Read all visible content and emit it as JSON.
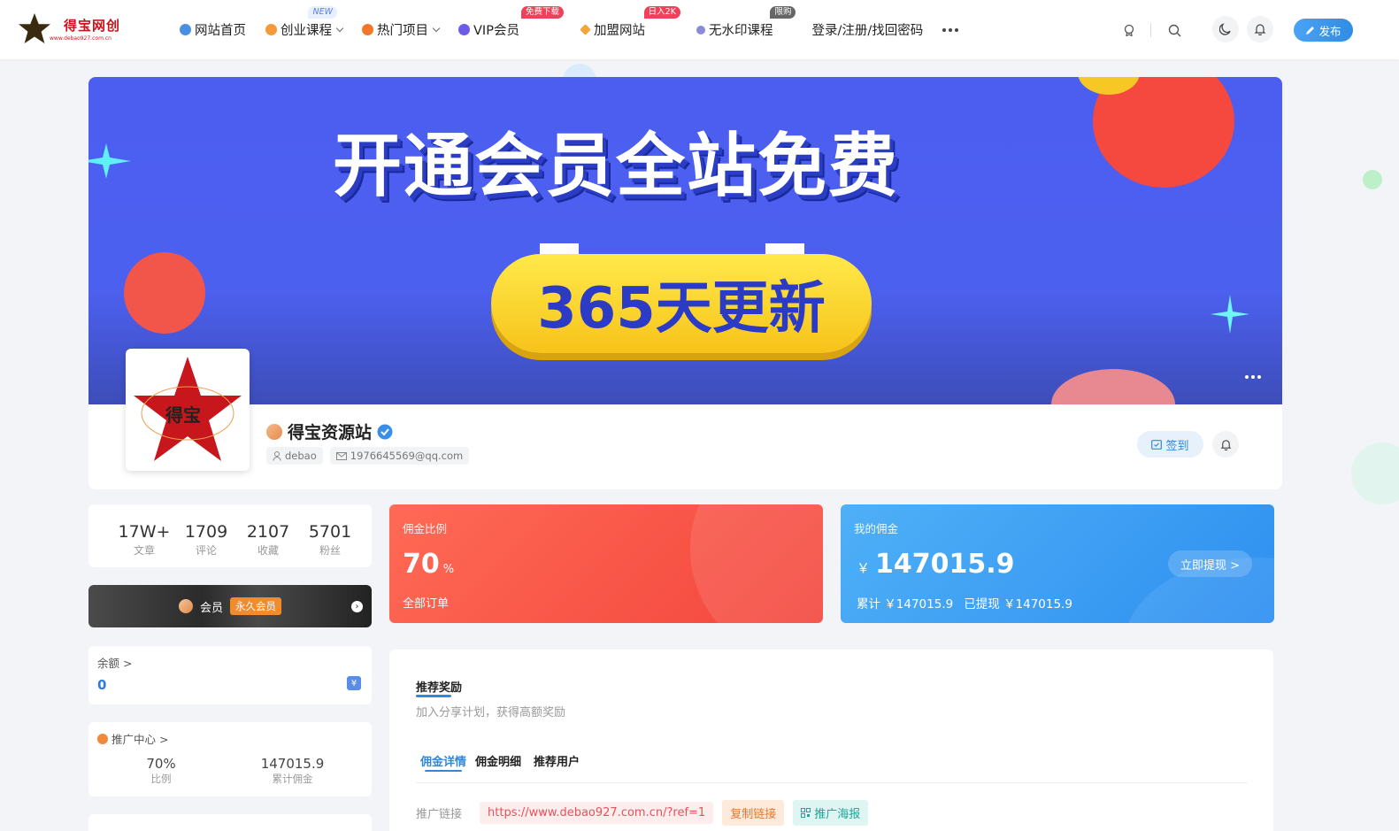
{
  "header": {
    "logo_text": "得宝网创",
    "logo_url": "www.debao927.com.cn",
    "nav": [
      {
        "label": "网站首页",
        "icon_color": "#4a90e2",
        "badge": "",
        "badge_color": "",
        "caret": false
      },
      {
        "label": "创业课程",
        "icon_color": "#f59a3a",
        "badge": "NEW",
        "badge_color": "#e8f0ff",
        "caret": true
      },
      {
        "label": "热门项目",
        "icon_color": "#f5762a",
        "badge": "",
        "badge_color": "",
        "caret": true
      },
      {
        "label": "VIP会员",
        "icon_color": "#6c5ce7",
        "badge": "免费下载",
        "badge_color": "#f0405a",
        "caret": false
      },
      {
        "label": "加盟网站",
        "icon_color": "#f2a63b",
        "badge": "日入2K",
        "badge_color": "#f0405a",
        "caret": false
      },
      {
        "label": "无水印课程",
        "icon_color": "#8a8ad8",
        "badge": "限购",
        "badge_color": "#666",
        "caret": false
      },
      {
        "label": "登录/注册/找回密码",
        "icon_color": "",
        "badge": "",
        "badge_color": "",
        "caret": false
      }
    ],
    "publish_label": "发布"
  },
  "banner": {
    "title": "开通会员全站免费",
    "pill_text": "365天更新"
  },
  "profile": {
    "avatar_text": "得宝",
    "name": "得宝资源站",
    "username": "debao",
    "email": "1976645569@qq.com",
    "checkin_label": "签到"
  },
  "stats": [
    {
      "value": "17W+",
      "label": "文章"
    },
    {
      "value": "1709",
      "label": "评论"
    },
    {
      "value": "2107",
      "label": "收藏"
    },
    {
      "value": "5701",
      "label": "粉丝"
    }
  ],
  "vip": {
    "label": "会员",
    "tag": "永久会员"
  },
  "balance": {
    "label": "余额 >",
    "value": "0",
    "icon": "¥"
  },
  "promo": {
    "label": "推广中心 >",
    "ratio_value": "70%",
    "ratio_label": "比例",
    "total_value": "147015.9",
    "total_label": "累计佣金"
  },
  "commission_ratio": {
    "label": "佣金比例",
    "value": "70",
    "unit": "%",
    "sub": "全部订单"
  },
  "my_commission": {
    "label": "我的佣金",
    "currency": "￥",
    "value": "147015.9",
    "withdraw_label": "立即提现 >",
    "total_text": "累计 ￥147015.9",
    "withdrawn_text": "已提现 ￥147015.9"
  },
  "reward": {
    "title": "推荐奖励",
    "desc": "加入分享计划，获得高额奖励",
    "tabs": [
      "佣金详情",
      "佣金明细",
      "推荐用户"
    ],
    "link_label": "推广链接",
    "link_url": "https://www.debao927.com.cn/?ref=1",
    "copy_label": "复制链接",
    "poster_label": "推广海报"
  },
  "colors": {
    "accent": "#2f88e0",
    "banner_bg": "#4b5ef0",
    "ratio_card": "#f3463d",
    "commission_card": "#2e8ff0"
  }
}
